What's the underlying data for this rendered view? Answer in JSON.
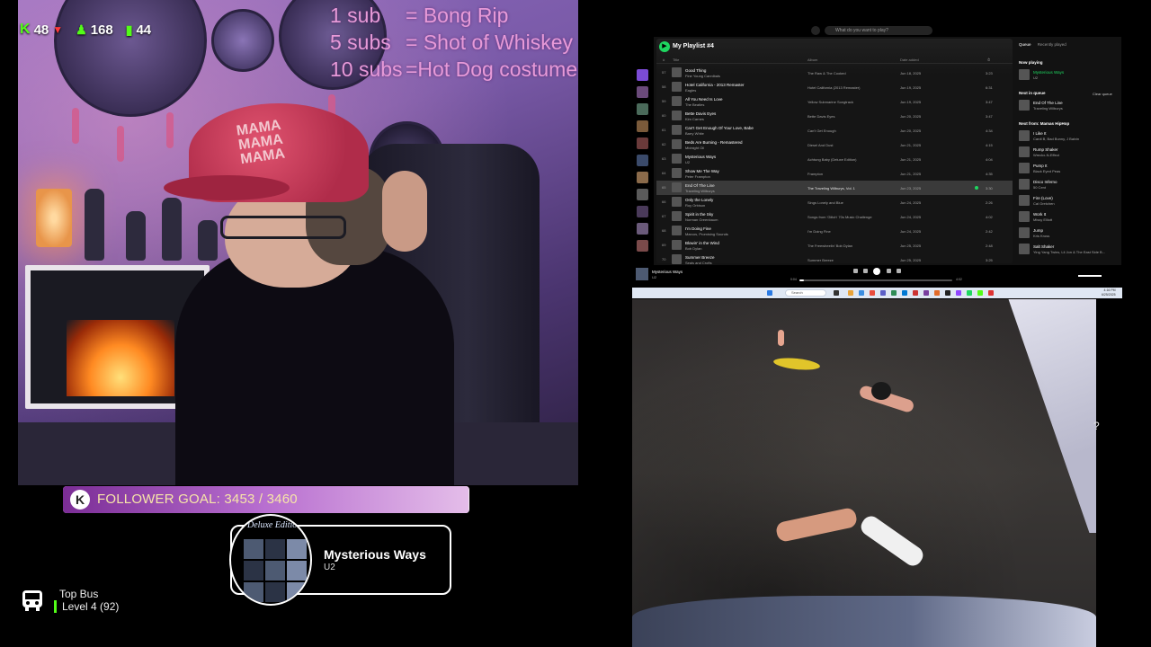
{
  "stats": {
    "kick_viewers": "48",
    "followers": "168",
    "subs_count": "44"
  },
  "sub_goals": [
    {
      "left": "1 sub",
      "right": "= Bong Rip"
    },
    {
      "left": "5 subs",
      "right": "= Shot of Whiskey"
    },
    {
      "left": "10 subs",
      "right": "=Hot Dog costume"
    }
  ],
  "cap_text": "MAMA MAMA MAMA",
  "follower_goal": {
    "badge": "K",
    "label": "FOLLOWER GOAL: 3453 / 3460",
    "progress": 0.998
  },
  "now_playing_card": {
    "album_text": "Deluxe Edition",
    "title": "Mysterious Ways",
    "artist": "U2"
  },
  "top_bus": {
    "name": "Top Bus",
    "level": "Level 4",
    "count": "(92)"
  },
  "spotify": {
    "search_placeholder": "What do you want to play?",
    "playlist_title": "My Playlist #4",
    "columns": {
      "num": "#",
      "title": "Title",
      "album": "Album",
      "date": "Date added",
      "duration": "⏱"
    },
    "rows": [
      {
        "num": "57",
        "title": "Good Thing",
        "artist": "Fine Young Cannibals",
        "album": "The Raw & The Cooked",
        "date": "Jun 18, 2025",
        "duration": "3:23"
      },
      {
        "num": "58",
        "title": "Hotel California - 2013 Remaster",
        "artist": "Eagles",
        "album": "Hotel California (2013 Remaster)",
        "date": "Jun 19, 2025",
        "duration": "6:31"
      },
      {
        "num": "59",
        "title": "All You Need Is Love",
        "artist": "The Beatles",
        "album": "Yellow Submarine Songtrack",
        "date": "Jun 19, 2025",
        "duration": "3:47"
      },
      {
        "num": "60",
        "title": "Bette Davis Eyes",
        "artist": "Kim Carnes",
        "album": "Bette Davis Eyes",
        "date": "Jun 20, 2025",
        "duration": "3:47"
      },
      {
        "num": "61",
        "title": "Can't Get Enough Of Your Love, Babe",
        "artist": "Barry White",
        "album": "Can't Get Enough",
        "date": "Jun 20, 2025",
        "duration": "4:34"
      },
      {
        "num": "62",
        "title": "Beds Are Burning - Remastered",
        "artist": "Midnight Oil",
        "album": "Diesel And Dust",
        "date": "Jun 21, 2025",
        "duration": "4:15"
      },
      {
        "num": "63",
        "title": "Mysterious Ways",
        "artist": "U2",
        "album": "Achtung Baby (Deluxe Edition)",
        "date": "Jun 21, 2025",
        "duration": "4:04"
      },
      {
        "num": "64",
        "title": "Show Me The Way",
        "artist": "Peter Frampton",
        "album": "Frampton",
        "date": "Jun 21, 2025",
        "duration": "4:35"
      },
      {
        "num": "65",
        "title": "End Of The Line",
        "artist": "Traveling Wilburys",
        "album": "The Traveling Wilburys, Vol. 1",
        "date": "Jun 23, 2025",
        "duration": "3:30"
      },
      {
        "num": "66",
        "title": "Only the Lonely",
        "artist": "Roy Orbison",
        "album": "Sings Lonely and Blue",
        "date": "Jun 24, 2025",
        "duration": "2:26"
      },
      {
        "num": "67",
        "title": "Spirit in the Sky",
        "artist": "Norman Greenbaum",
        "album": "Songs from 'Glitch' 70s Music Challenge",
        "date": "Jun 24, 2025",
        "duration": "4:02"
      },
      {
        "num": "68",
        "title": "I'm Doing Fine",
        "artist": "Marcos, Promising Sounds",
        "album": "I'm Doing Fine",
        "date": "Jun 24, 2025",
        "duration": "2:42"
      },
      {
        "num": "69",
        "title": "Blowin' in the Wind",
        "artist": "Bob Dylan",
        "album": "The Freewheelin' Bob Dylan",
        "date": "Jun 25, 2025",
        "duration": "2:48"
      },
      {
        "num": "70",
        "title": "Summer Breeze",
        "artist": "Seals and Crofts",
        "album": "Summer Breeze",
        "date": "Jun 25, 2025",
        "duration": "3:25"
      }
    ],
    "active_row_index": 8,
    "queue": {
      "tab_queue": "Queue",
      "tab_recent": "Recently played",
      "now_playing_heading": "Now playing",
      "now_playing": {
        "title": "Mysterious Ways",
        "artist": "U2"
      },
      "next_in_queue_heading": "Next in queue",
      "clear_label": "Clear queue",
      "next_in_queue": {
        "title": "End Of The Line",
        "artist": "Traveling Wilburys"
      },
      "next_from_heading": "Next from: Mamas HipHop",
      "next_from": [
        {
          "title": "I Like It",
          "artist": "Cardi B, Bad Bunny, J Balvin"
        },
        {
          "title": "Rump Shaker",
          "artist": "Wreckx-N-Effect"
        },
        {
          "title": "Pump It",
          "artist": "Black Eyed Peas"
        },
        {
          "title": "Disco Inferno",
          "artist": "50 Cent"
        },
        {
          "title": "Fire (Love)",
          "artist": "Cal Gretchen"
        },
        {
          "title": "Work It",
          "artist": "Missy Elliott"
        },
        {
          "title": "Jump",
          "artist": "Kris Kross"
        },
        {
          "title": "Salt Shaker",
          "artist": "Ying Yang Twins, Lil Jon & The East Side B..."
        }
      ]
    },
    "player": {
      "title": "Mysterious Ways",
      "artist": "U2",
      "elapsed": "0:04",
      "total": "4:02",
      "progress": 0.03
    }
  },
  "taskbar": {
    "search_label": "Search",
    "time": "4:16 PM",
    "date": "6/25/2025"
  },
  "colors": {
    "kick_green": "#53fc18",
    "spotify_green": "#1ed760",
    "sub_text": "#e79ad8",
    "goal_text": "#f7e6a8"
  }
}
